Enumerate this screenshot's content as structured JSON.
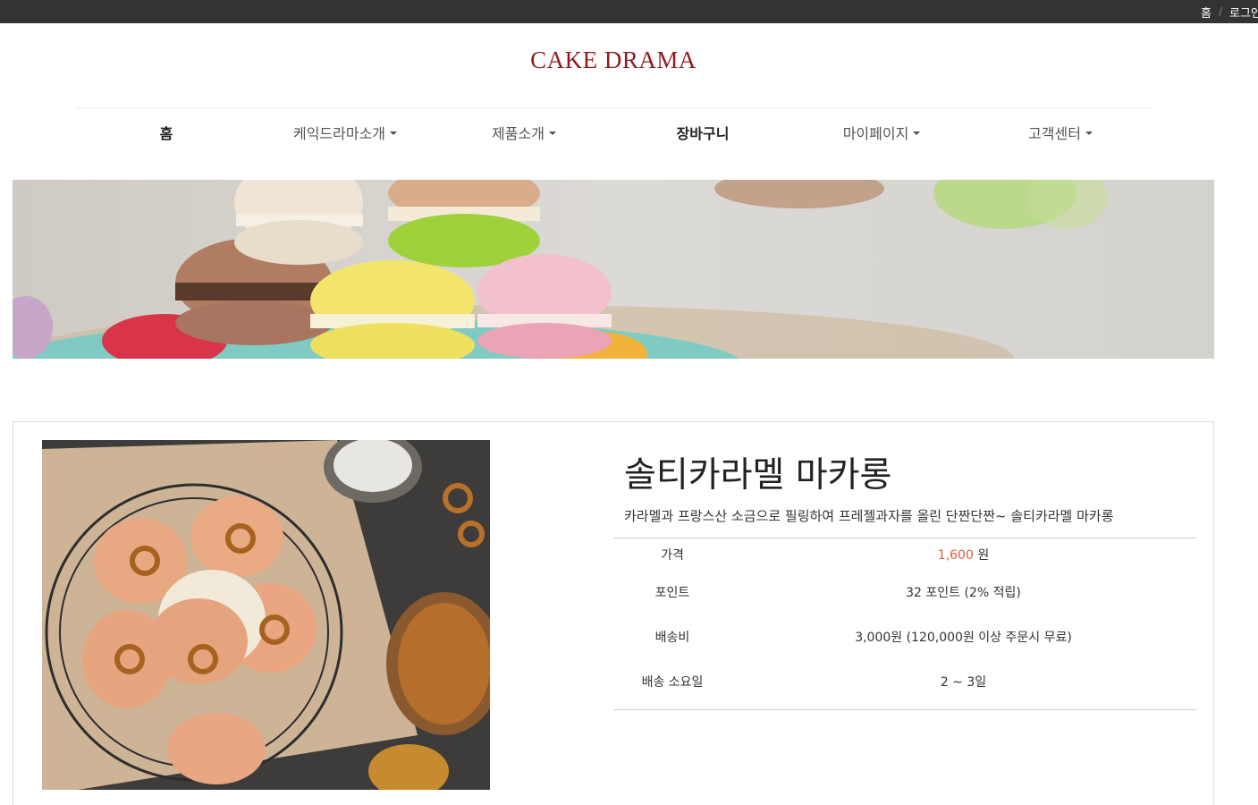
{
  "topbar": {
    "links": [
      "홈",
      "로그인"
    ]
  },
  "brand": {
    "logo": "CAKE DRAMA",
    "color": "#8f1b1f"
  },
  "nav": {
    "items": [
      {
        "label": "홈",
        "dropdown": false
      },
      {
        "label": "케익드라마소개",
        "dropdown": true
      },
      {
        "label": "제품소개",
        "dropdown": true
      },
      {
        "label": "장바구니",
        "dropdown": false
      },
      {
        "label": "마이페이지",
        "dropdown": true
      },
      {
        "label": "고객센터",
        "dropdown": true
      }
    ]
  },
  "product": {
    "name": "솔티카라멜 마카롱",
    "description": "카라멜과 프랑스산 소금으로 필링하여 프레젤과자를 올린 단짠단짠~ 솔티카라멜 마카롱",
    "price_label": "가격",
    "price_value": "1,600",
    "price_unit": "원",
    "point_label": "포인트",
    "point_value": "32 포인트 (2% 적립)",
    "shipping_label": "배송비",
    "shipping_value": "3,000원 (120,000원 이상 주문시 무료)",
    "delivery_label": "배송 소요일",
    "delivery_value": "2 ~ 3일",
    "accent_color": "#e25a3c"
  }
}
